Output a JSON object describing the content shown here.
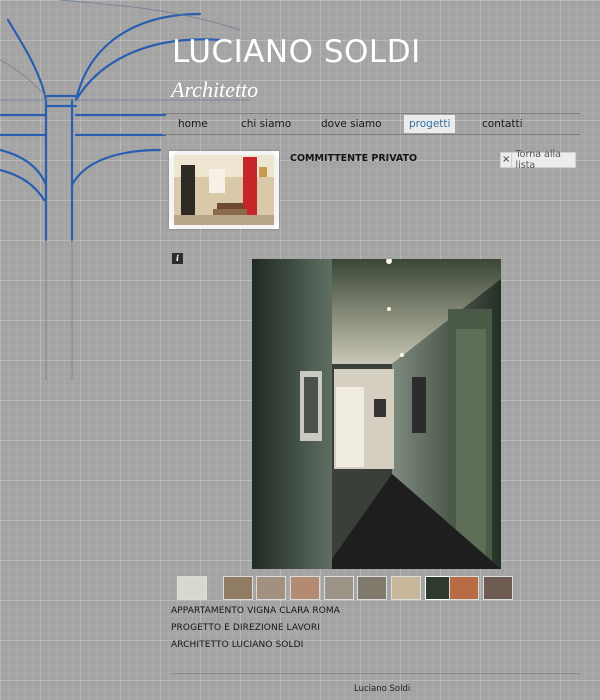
{
  "header": {
    "title": "LUCIANO SOLDI",
    "subtitle": "Architetto"
  },
  "nav": {
    "items": [
      {
        "label": "home",
        "active": false
      },
      {
        "label": "chi siamo",
        "active": false
      },
      {
        "label": "dove siamo",
        "active": false
      },
      {
        "label": "progetti",
        "active": true
      },
      {
        "label": "contatti",
        "active": false
      }
    ]
  },
  "project": {
    "client": "COMMITTENTE PRIVATO",
    "back_label": "Torna alla lista",
    "back_icon": "close-icon",
    "info_icon": "info-icon",
    "info_glyph": "i",
    "thumbnail_count": 10,
    "selected_thumbnail": 8,
    "description": [
      "APPARTAMENTO VIGNA CLARA ROMA",
      "PROGETTO E DIREZIONE LAVORI",
      "ARCHITETTO LUCIANO SOLDI"
    ]
  },
  "footer": {
    "text": "Luciano Soldi"
  },
  "colors": {
    "background": "#a4a4a4",
    "accent": "#2f6ea0",
    "sketch_blue": "#2a5fb0"
  }
}
